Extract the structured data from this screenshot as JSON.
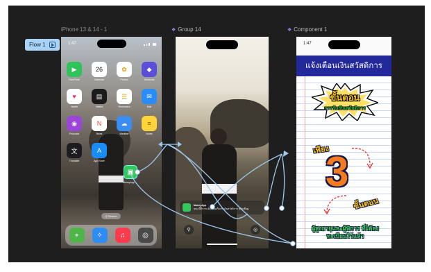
{
  "canvas": {
    "background": "#1e1e1e",
    "flow_tag": {
      "label": "Flow 1"
    },
    "frames": [
      {
        "label": "iPhone 13 & 14 - 1",
        "kind": "frame"
      },
      {
        "label": "Group 14",
        "kind": "component"
      },
      {
        "label": "Component 1",
        "kind": "component"
      }
    ]
  },
  "phone1": {
    "time": "1:47",
    "apps": [
      {
        "name": "FaceTime",
        "icon": "facetime-icon",
        "color": "#2fc35a",
        "glyph": "▶"
      },
      {
        "name": "Calendar",
        "icon": "calendar-icon",
        "color": "#ffffff",
        "glyph": "26"
      },
      {
        "name": "Photos",
        "icon": "photos-icon",
        "color": "#ffffff",
        "glyph": "✿"
      },
      {
        "name": "Shortcuts",
        "icon": "shortcuts-icon",
        "color": "#5b4fd8",
        "glyph": "◆"
      },
      {
        "name": "Health",
        "icon": "health-icon",
        "color": "#ffffff",
        "glyph": "♥"
      },
      {
        "name": "Wallet",
        "icon": "wallet-icon",
        "color": "#1b1b1b",
        "glyph": "▤"
      },
      {
        "name": "Reminders",
        "icon": "reminders-icon",
        "color": "#ffffff",
        "glyph": "☰"
      },
      {
        "name": "Mail",
        "icon": "mail-icon",
        "color": "#2a8cf5",
        "glyph": "✉"
      },
      {
        "name": "Podcasts",
        "icon": "podcasts-icon",
        "color": "#9b45d9",
        "glyph": "◉"
      },
      {
        "name": "News",
        "icon": "news-icon",
        "color": "#ffffff",
        "glyph": "N"
      },
      {
        "name": "Weather",
        "icon": "weather-icon",
        "color": "#3b8ef0",
        "glyph": "☁"
      },
      {
        "name": "Notes",
        "icon": "notes-icon",
        "color": "#ffd43b",
        "glyph": "≡"
      },
      {
        "name": "Translate",
        "icon": "translate-icon",
        "color": "#1c1c1e",
        "glyph": "文"
      },
      {
        "name": "App Store",
        "icon": "app-store-icon",
        "color": "#1a8cf7",
        "glyph": "A"
      }
    ],
    "target_app": {
      "name": "MoneyApp",
      "icon": "target-app-icon",
      "color": "#34c759",
      "glyph": "▣"
    },
    "search_label": "Q Search",
    "dock": [
      {
        "icon": "maps-icon",
        "color": "#4fb54b",
        "glyph": "⌖"
      },
      {
        "icon": "safari-icon",
        "color": "#2e8df5",
        "glyph": "✧"
      },
      {
        "icon": "music-icon",
        "color": "#fb3c4f",
        "glyph": "♫"
      },
      {
        "icon": "camera-icon",
        "color": "#4a4a4a",
        "glyph": "◎"
      }
    ]
  },
  "phone2": {
    "notification": {
      "app": "MoneyApp",
      "text": "ขณะนี้มีการแจ้งเตือนเกี่ยวกับเงินสวัสดิการ คลิกเพื่อดู"
    },
    "flashlight_glyph": "⚲",
    "camera_glyph": "◎"
  },
  "component1": {
    "time": "1:47",
    "header": "แจ้งเตือนเงินสวัสดิการ",
    "burst_title": "ขั้นตอน",
    "burst_sub": "การรับเงินสวัสดิการ",
    "only": "เพียง",
    "number": "3",
    "steps": "ขั้นตอน",
    "bottom": "ผู้สูงอายุและผู้พิการ ที่ได้ลงทะเบียนไว้แล้ว"
  },
  "colors": {
    "accent_flow": "#a9d3f6",
    "connector": "#9fc8ee",
    "header_blue": "#23289b",
    "highlight_yellow": "#f6c20c",
    "number_orange": "#f47c20",
    "green_text": "#3ad14a"
  }
}
